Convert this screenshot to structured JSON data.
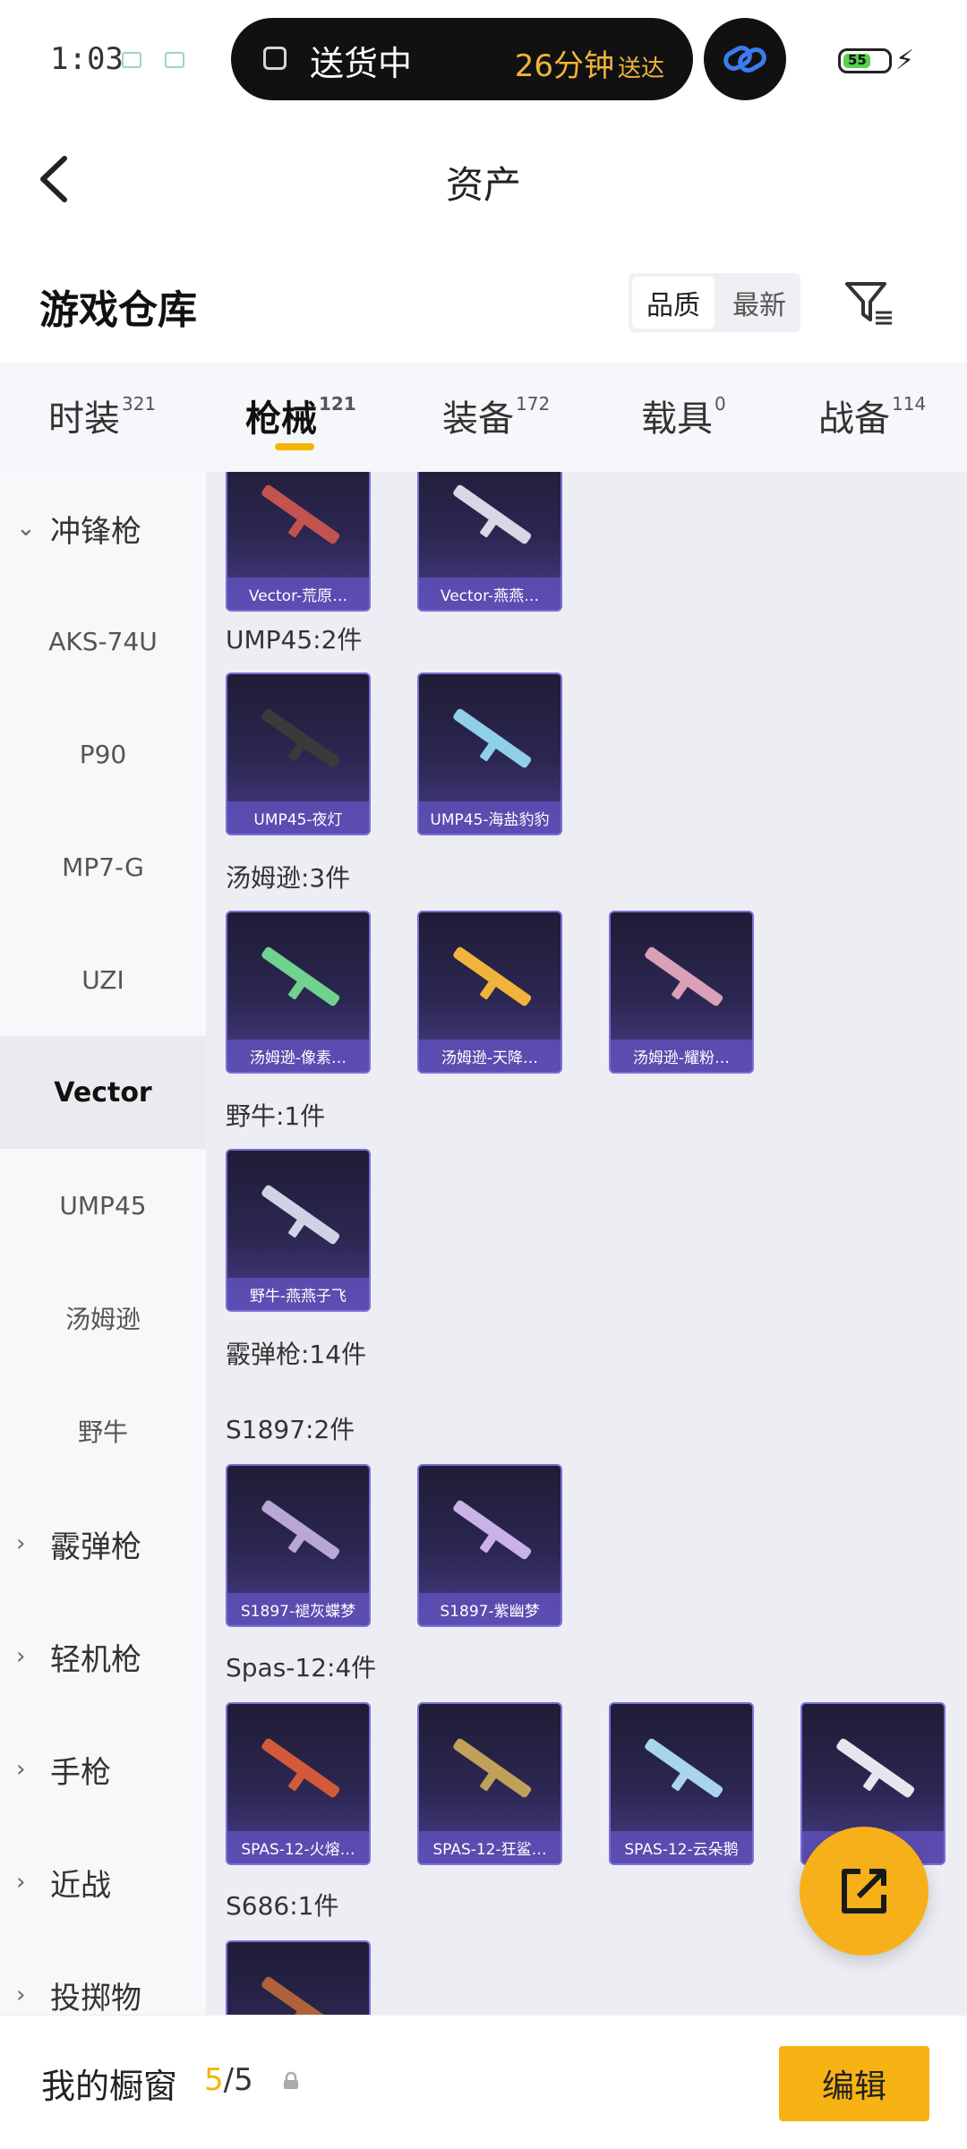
{
  "status_bar": {
    "time": "1:03",
    "battery_level": "55",
    "island_text": "送货中",
    "island_eta": "26分钟",
    "island_eta_suffix": "送达"
  },
  "header": {
    "title": "资产"
  },
  "section": {
    "title": "游戏仓库",
    "sort_options": [
      "品质",
      "最新"
    ],
    "sort_active": "品质"
  },
  "tabs": [
    {
      "label": "时装",
      "count": "321"
    },
    {
      "label": "枪械",
      "count": "121",
      "active": true
    },
    {
      "label": "装备",
      "count": "172"
    },
    {
      "label": "载具",
      "count": "0"
    },
    {
      "label": "战备",
      "count": "114"
    }
  ],
  "sidebar": {
    "items": [
      {
        "label": "冲锋枪",
        "type": "parent",
        "expanded": true
      },
      {
        "label": "AKS-74U",
        "type": "child"
      },
      {
        "label": "P90",
        "type": "child"
      },
      {
        "label": "MP7-G",
        "type": "child"
      },
      {
        "label": "UZI",
        "type": "child"
      },
      {
        "label": "Vector",
        "type": "child",
        "active": true
      },
      {
        "label": "UMP45",
        "type": "child"
      },
      {
        "label": "汤姆逊",
        "type": "child"
      },
      {
        "label": "野牛",
        "type": "child"
      },
      {
        "label": "霰弹枪",
        "type": "parent"
      },
      {
        "label": "轻机枪",
        "type": "parent"
      },
      {
        "label": "手枪",
        "type": "parent"
      },
      {
        "label": "近战",
        "type": "parent"
      },
      {
        "label": "投掷物",
        "type": "parent"
      }
    ]
  },
  "content": {
    "group_labels": [
      "UMP45:2件",
      "汤姆逊:3件",
      "野牛:1件",
      "霰弹枪:14件",
      "S1897:2件",
      "Spas-12:4件",
      "S686:1件"
    ],
    "cards": [
      {
        "label": "Vector-荒原…",
        "color": "#c2534f"
      },
      {
        "label": "Vector-燕燕…",
        "color": "#d9d6e6"
      },
      {
        "label": "UMP45-夜灯",
        "color": "#3a3a3a"
      },
      {
        "label": "UMP45-海盐豹豹",
        "color": "#8fd0e8"
      },
      {
        "label": "汤姆逊-像素…",
        "color": "#6fd38f"
      },
      {
        "label": "汤姆逊-天降…",
        "color": "#f0b43c"
      },
      {
        "label": "汤姆逊-耀粉…",
        "color": "#d9a0b8"
      },
      {
        "label": "野牛-燕燕子飞",
        "color": "#cfd3e6"
      },
      {
        "label": "S1897-褪灰蝶梦",
        "color": "#b8a7d6"
      },
      {
        "label": "S1897-紫幽梦",
        "color": "#c8b2e8"
      },
      {
        "label": "SPAS-12-火熔…",
        "color": "#d25a3a"
      },
      {
        "label": "SPAS-12-狂鲨…",
        "color": "#bfa15a"
      },
      {
        "label": "SPAS-12-云朵鹅",
        "color": "#a8d4ec"
      },
      {
        "label": "",
        "color": "#e6e6ef"
      },
      {
        "label": "",
        "color": "#b0623a"
      }
    ]
  },
  "bottom_bar": {
    "title": "我的橱窗",
    "count_current": "5",
    "count_sep_total": "/5",
    "edit_label": "编辑"
  }
}
